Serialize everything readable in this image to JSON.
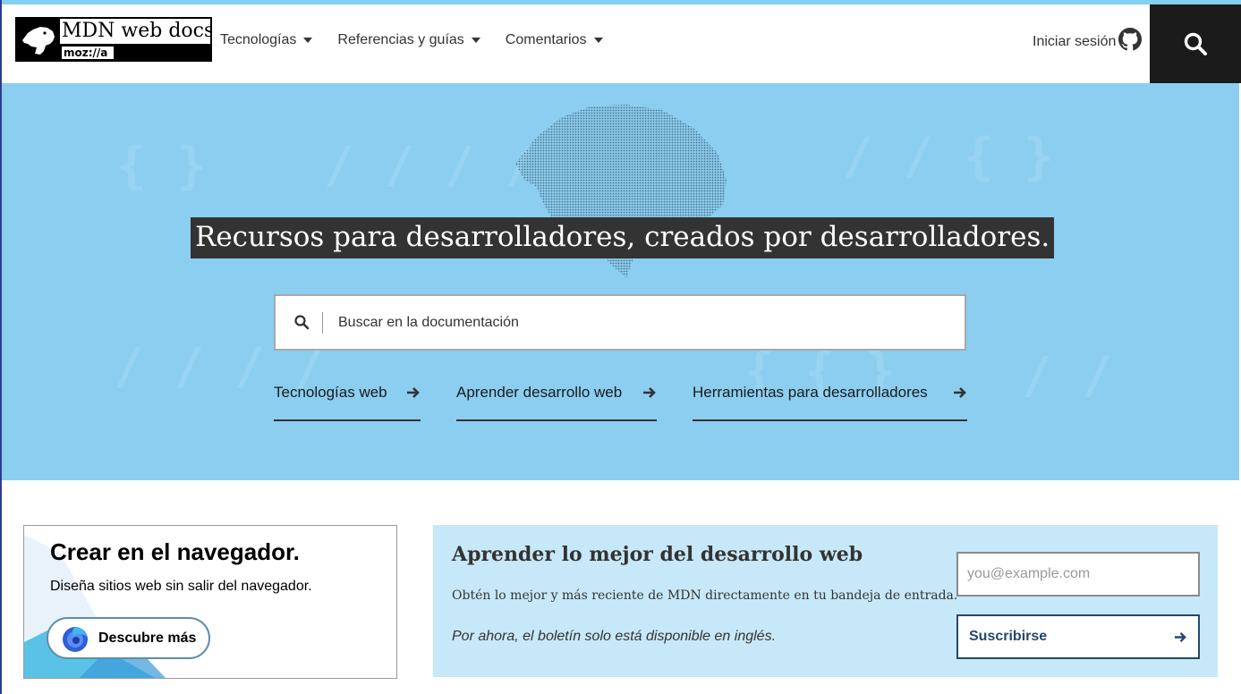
{
  "header": {
    "logo_text": "MDN web docs",
    "logo_sub": "moz://a",
    "nav": [
      {
        "label": "Tecnologías"
      },
      {
        "label": "Referencias y guías"
      },
      {
        "label": "Comentarios"
      }
    ],
    "login_label": "Iniciar sesión"
  },
  "hero": {
    "headline": "Recursos para desarrolladores, creados por desarrolladores.",
    "search_placeholder": "Buscar en la documentación",
    "links": [
      {
        "label": "Tecnologías web"
      },
      {
        "label": "Aprender desarrollo web"
      },
      {
        "label": "Herramientas para desarrolladores"
      }
    ]
  },
  "promo": {
    "title": "Crear en el navegador.",
    "text": "Diseña sitios web sin salir del navegador.",
    "cta": "Descubre más"
  },
  "newsletter": {
    "title": "Aprender lo mejor del desarrollo web",
    "desc": "Obtén lo mejor y más reciente de MDN directamente en tu bandeja de entrada.",
    "note": "Por ahora, el boletín solo está disponible en inglés.",
    "email_placeholder": "you@example.com",
    "subscribe": "Suscribirse"
  },
  "colors": {
    "hero_bg": "#8bcef0",
    "newsletter_bg": "#c7e8f8",
    "accent": "#25486b"
  }
}
